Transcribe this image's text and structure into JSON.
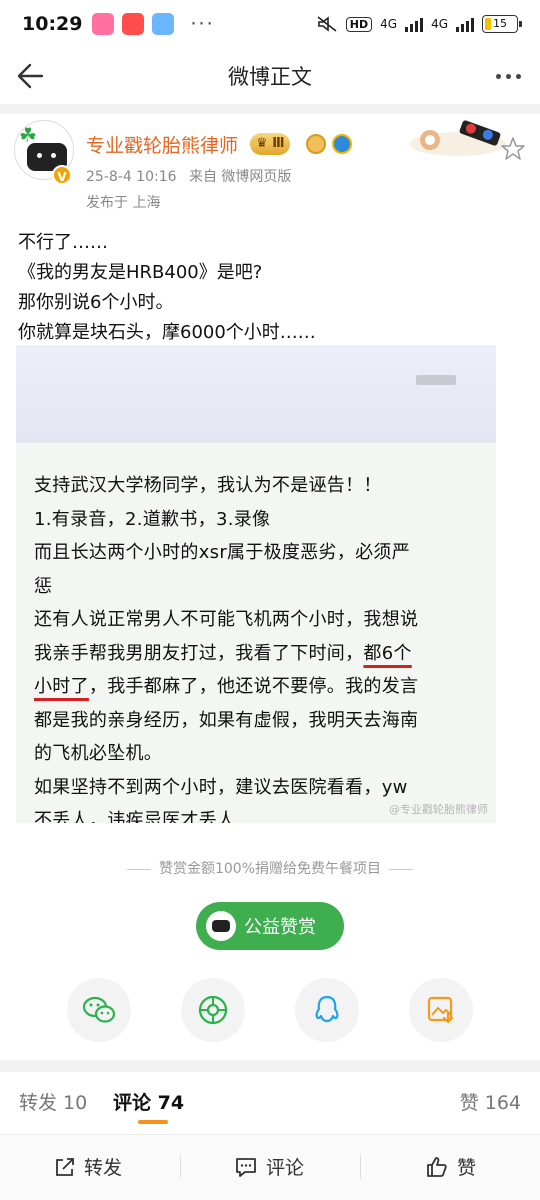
{
  "status_bar": {
    "time": "10:29",
    "hd_badge": "HD",
    "network_1": "4G",
    "network_2": "4G",
    "battery": "15"
  },
  "nav": {
    "title": "微博正文"
  },
  "post": {
    "author": "专业戳轮胎熊律师",
    "level_badge": "Ⅲ",
    "date": "25-8-4 10:16",
    "source": "来自 微博网页版",
    "location": "发布于 上海",
    "text_lines": [
      "不行了……",
      "《我的男友是HRB400》是吧?",
      "那你别说6个小时。",
      "你就算是块石头，摩6000个小时……"
    ],
    "image": {
      "lines": [
        "支持武汉大学杨同学，我认为不是诬告！！",
        "1.有录音，2.道歉书，3.录像",
        "而且长达两个小时的xsr属于极度恶劣，必须严",
        "惩",
        "还有人说正常男人不可能飞机两个小时，我想说",
        "我亲手帮我男朋友打过，我看了下时间，",
        "都6个",
        "小时了",
        "，我手都麻了，他还说不要停。我的发言",
        "都是我的亲身经历，如果有虚假，我明天去海南",
        "的飞机必坠机。",
        "如果坚持不到两个小时，建议去医院看看，yw",
        "不丢人，讳疾忌医才丢人"
      ],
      "watermark": "@专业戳轮胎熊律师"
    }
  },
  "reward": {
    "note": "赞赏金额100%捐赠给免费午餐项目",
    "button_label": "公益赞赏"
  },
  "tabs": {
    "repost": "转发 10",
    "comment": "评论 74",
    "like": "赞 164"
  },
  "bottom_bar": {
    "repost": "转发",
    "comment": "评论",
    "like": "赞"
  },
  "colors": {
    "username": "#e8641f",
    "reward_green": "#3fae4f",
    "tab_underline": "#f5921e",
    "highlight_underline": "#d42020"
  }
}
